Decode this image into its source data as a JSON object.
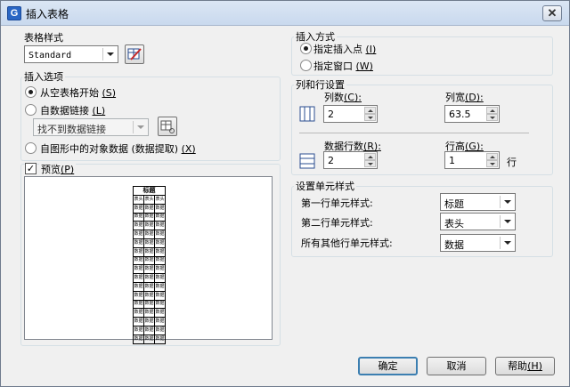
{
  "window": {
    "title": "插入表格",
    "app_icon_letter": "G",
    "close_glyph": "✕"
  },
  "table_style": {
    "label": "表格样式",
    "selected": "Standard",
    "launch_button_icon": "table-style-launch-icon"
  },
  "insert_options": {
    "label": "插入选项",
    "from_empty": "从空表格开始",
    "from_empty_key": "(S)",
    "from_data_link": "自数据链接",
    "from_data_link_key": "(L)",
    "data_link_value": "找不到数据链接",
    "from_objects": "自图形中的对象数据 (数据提取)",
    "from_objects_key": "(X)",
    "selected": "from_empty"
  },
  "preview": {
    "label": "预览",
    "label_key": "(P)",
    "checked": true,
    "table": {
      "title": "标题",
      "header": [
        "表头",
        "表头",
        "表头"
      ],
      "cell": "数据",
      "data_rows": 16
    }
  },
  "insert_method": {
    "label": "插入方式",
    "point": "指定插入点",
    "point_key": "(I)",
    "window": "指定窗口",
    "window_key": "(W)",
    "selected": "point"
  },
  "rows_columns": {
    "label": "列和行设置",
    "columns_label": "列数",
    "columns_key": "(C):",
    "columns_value": "2",
    "column_width_label": "列宽",
    "column_width_key": "(D):",
    "column_width_value": "63.5",
    "data_rows_label": "数据行数",
    "data_rows_key": "(R):",
    "data_rows_value": "2",
    "row_height_label": "行高",
    "row_height_key": "(G):",
    "row_height_value": "1",
    "row_unit": "行"
  },
  "cell_styles": {
    "label": "设置单元样式",
    "first_row_label": "第一行单元样式:",
    "first_row_value": "标题",
    "second_row_label": "第二行单元样式:",
    "second_row_value": "表头",
    "other_rows_label": "所有其他行单元样式:",
    "other_rows_value": "数据"
  },
  "buttons": {
    "ok": "确定",
    "cancel": "取消",
    "help": "帮助",
    "help_key": "(H)"
  }
}
